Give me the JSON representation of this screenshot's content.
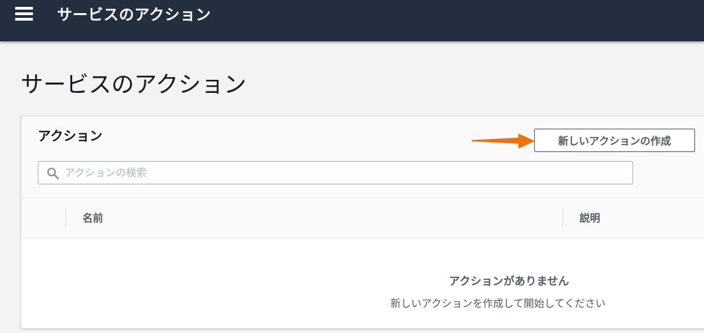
{
  "header": {
    "title": "サービスのアクション"
  },
  "page": {
    "title": "サービスのアクション"
  },
  "panel": {
    "title": "アクション",
    "create_button_label": "新しいアクションの作成",
    "search": {
      "placeholder": "アクションの検索",
      "value": ""
    },
    "table": {
      "columns": [
        "名前",
        "説明"
      ],
      "rows": []
    },
    "empty_state": {
      "title": "アクションがありません",
      "description": "新しいアクションを作成して開始してください"
    }
  },
  "icons": {
    "menu": "hamburger-menu-icon",
    "search": "search-icon",
    "annotation": "orange-arrow-icon"
  },
  "colors": {
    "topbar": "#232f3e",
    "annotation_arrow": "#ec7211",
    "text_primary": "#16191f",
    "text_secondary": "#545b64"
  }
}
